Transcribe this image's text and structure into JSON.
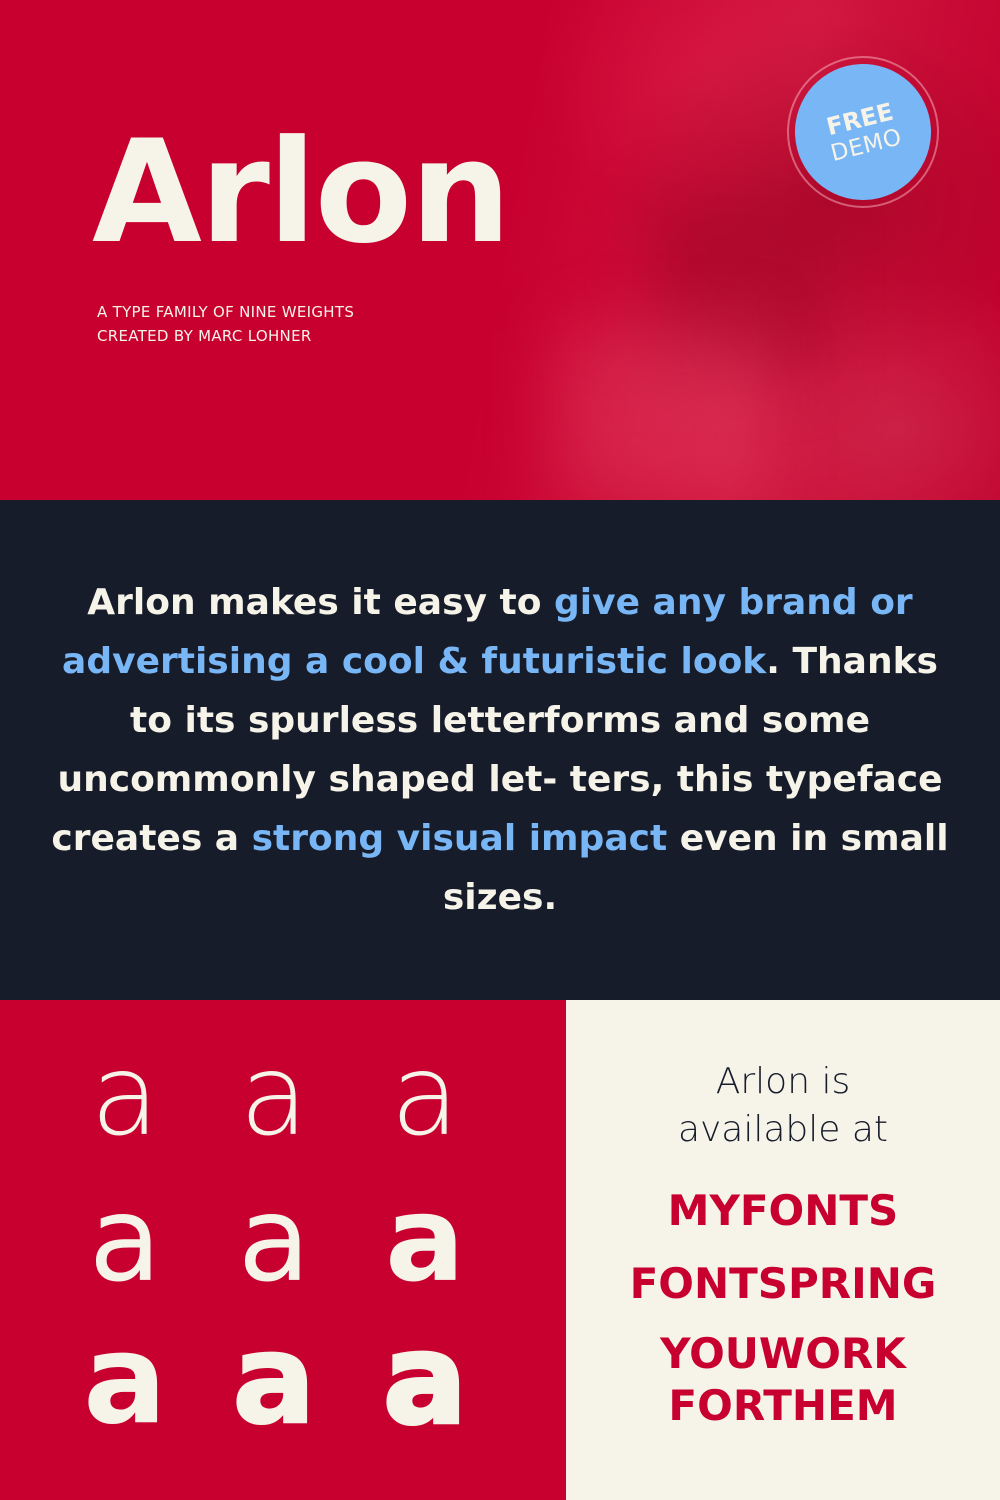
{
  "hero": {
    "title": "Arlon",
    "subtitle_lines": [
      "A TYPE FAMILY OF NINE WEIGHTS",
      "CREATED BY MARC LOHNER"
    ],
    "badge": {
      "top": "FREE",
      "bottom": "DEMO"
    },
    "colors": {
      "background": "#c8002f",
      "text": "#f6f3e9",
      "badge": "#79b6f5"
    }
  },
  "pitch": {
    "segments": [
      {
        "text": "Arlon makes it easy to ",
        "highlight": false
      },
      {
        "text": "give any brand or advertising a cool & futuristic look",
        "highlight": true
      },
      {
        "text": ". Thanks to its spurless letterforms and some uncommonly shaped let- ters, this typeface creates a ",
        "highlight": false
      },
      {
        "text": "strong visual impact",
        "highlight": true
      },
      {
        "text": " even in small sizes.",
        "highlight": false
      }
    ],
    "colors": {
      "background": "#171c2b",
      "text": "#f6f3e9",
      "highlight": "#79b6f5"
    }
  },
  "weights": {
    "glyph": "a",
    "count": 9,
    "colors": {
      "background": "#c8002f",
      "glyph": "#f6f3e9"
    }
  },
  "availability": {
    "lines": [
      "Arlon is",
      "available at"
    ],
    "vendors": [
      "MYFONTS",
      "FONTSPRING",
      "YOUWORK FORTHEM"
    ],
    "vendor_lines": {
      "youworkforthem": [
        "YOUWORK",
        "FORTHEM"
      ]
    },
    "colors": {
      "background": "#f6f3e9",
      "text": "#171c2b",
      "vendor": "#c8002f"
    }
  }
}
